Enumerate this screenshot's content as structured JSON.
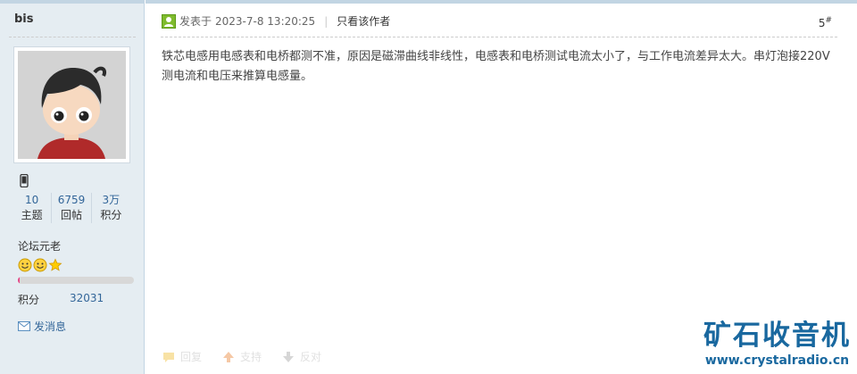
{
  "user": {
    "name": "bis",
    "stats": [
      {
        "value": "10",
        "label": "主题"
      },
      {
        "value": "6759",
        "label": "回帖"
      },
      {
        "value": "3万",
        "label": "积分"
      }
    ],
    "rank": "论坛元老",
    "level_progress_fraction": 0.015,
    "points_label": "积分",
    "points_value": "32031",
    "message_link": "发消息"
  },
  "post": {
    "posted_prefix": "发表于",
    "posted_time": "2023-7-8 13:20:25",
    "only_author": "只看该作者",
    "floor": "5",
    "floor_suffix": "#",
    "content": "铁芯电感用电感表和电桥都测不准，原因是磁滞曲线非线性，电感表和电桥测试电流太小了，与工作电流差异太大。串灯泡接220V测电流和电压来推算电感量。",
    "actions": [
      {
        "label": "回复",
        "icon": "reply-icon"
      },
      {
        "label": "支持",
        "icon": "thumb-up-icon"
      },
      {
        "label": "反对",
        "icon": "thumb-down-icon"
      }
    ]
  },
  "watermark": {
    "title": "矿石收音机",
    "url": "www.crystalradio.cn"
  },
  "colors": {
    "sidebar_bg": "#e5edf2",
    "link": "#336699",
    "watermark": "#19689f",
    "progress": "#e54787"
  }
}
